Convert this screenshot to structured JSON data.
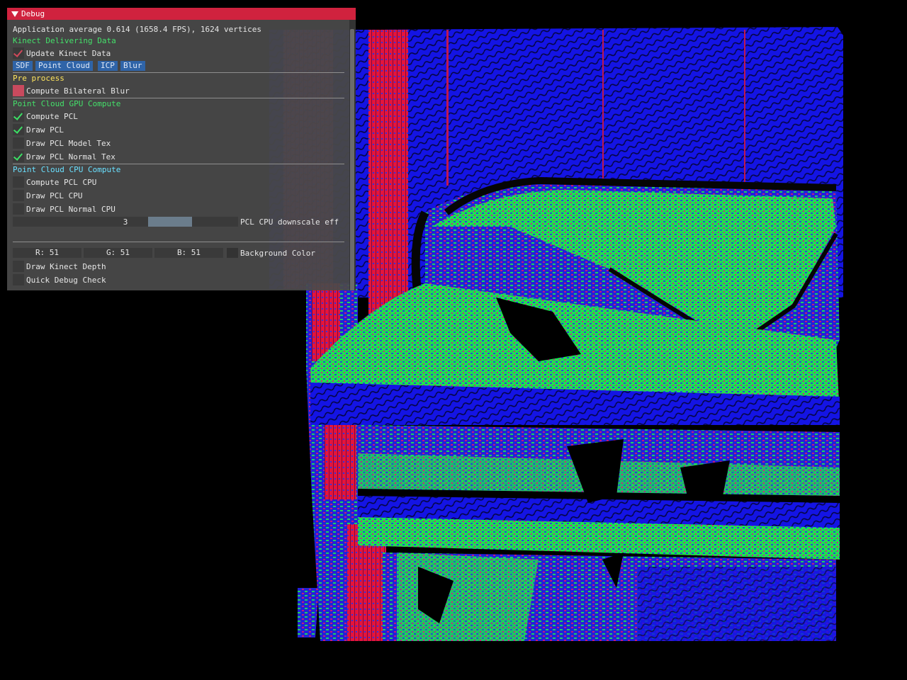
{
  "window": {
    "title": "Debug",
    "fps_line": "Application average 0.614 (1658.4 FPS), 1624 vertices",
    "status": "Kinect Delivering Data",
    "update_kinect": {
      "label": "Update Kinect Data",
      "checked": true
    },
    "tabs": [
      "SDF",
      "Point Cloud",
      "ICP",
      "Blur"
    ],
    "pre_process": {
      "header": "Pre process",
      "items": [
        {
          "label": "Compute Bilateral Blur",
          "checked": true
        }
      ]
    },
    "gpu": {
      "header": "Point Cloud GPU Compute",
      "items": [
        {
          "label": "Compute PCL",
          "checked": true
        },
        {
          "label": "Draw PCL",
          "checked": true
        },
        {
          "label": "Draw PCL Model Tex",
          "checked": false
        },
        {
          "label": "Draw PCL Normal Tex",
          "checked": true
        }
      ]
    },
    "cpu": {
      "header": "Point Cloud CPU Compute",
      "items": [
        {
          "label": "Compute PCL CPU",
          "checked": false
        },
        {
          "label": "Draw PCL CPU",
          "checked": false
        },
        {
          "label": "Draw PCL Normal CPU",
          "checked": false
        }
      ],
      "downscale": {
        "value": "3",
        "label": "PCL CPU downscale eff"
      }
    },
    "background": {
      "r": "R: 51",
      "g": "G: 51",
      "b": "B: 51",
      "label": "Background Color",
      "swatch": "#333333"
    },
    "extras": [
      {
        "label": "Draw Kinect Depth",
        "checked": false
      },
      {
        "label": "Quick Debug Check",
        "checked": false
      }
    ]
  },
  "colors": {
    "title_bar": "#d0223e",
    "accent_green": "#44e06a",
    "accent_yellow": "#ffe55c",
    "accent_cyan": "#6ae0ff",
    "tab_blue": "#2f64a8",
    "normal_red": "#e8163c",
    "normal_green": "#1ee84c",
    "normal_blue": "#1212e6"
  }
}
